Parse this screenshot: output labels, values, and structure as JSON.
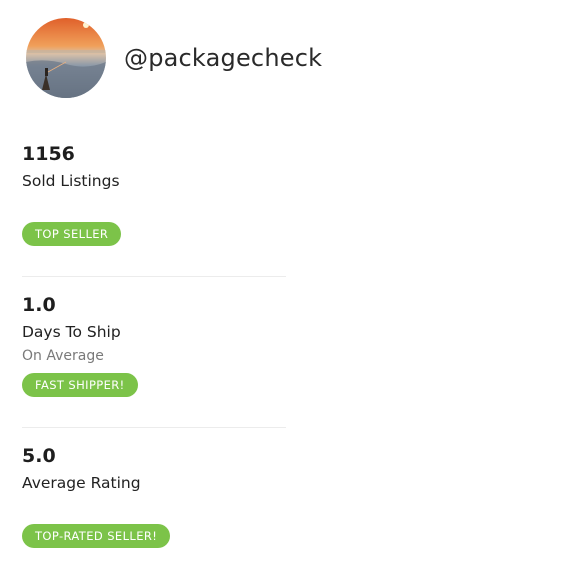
{
  "profile": {
    "username": "@packagecheck"
  },
  "stats": [
    {
      "value": "1156",
      "label": "Sold Listings",
      "sub": "",
      "badge": "TOP SELLER"
    },
    {
      "value": "1.0",
      "label": "Days To Ship",
      "sub": "On Average",
      "badge": "FAST SHIPPER!"
    },
    {
      "value": "5.0",
      "label": "Average Rating",
      "sub": "",
      "badge": "TOP-RATED SELLER!"
    }
  ],
  "colors": {
    "badge_green": "#7cc349",
    "divider": "#ececec",
    "sub_text": "#7a7a7a"
  }
}
